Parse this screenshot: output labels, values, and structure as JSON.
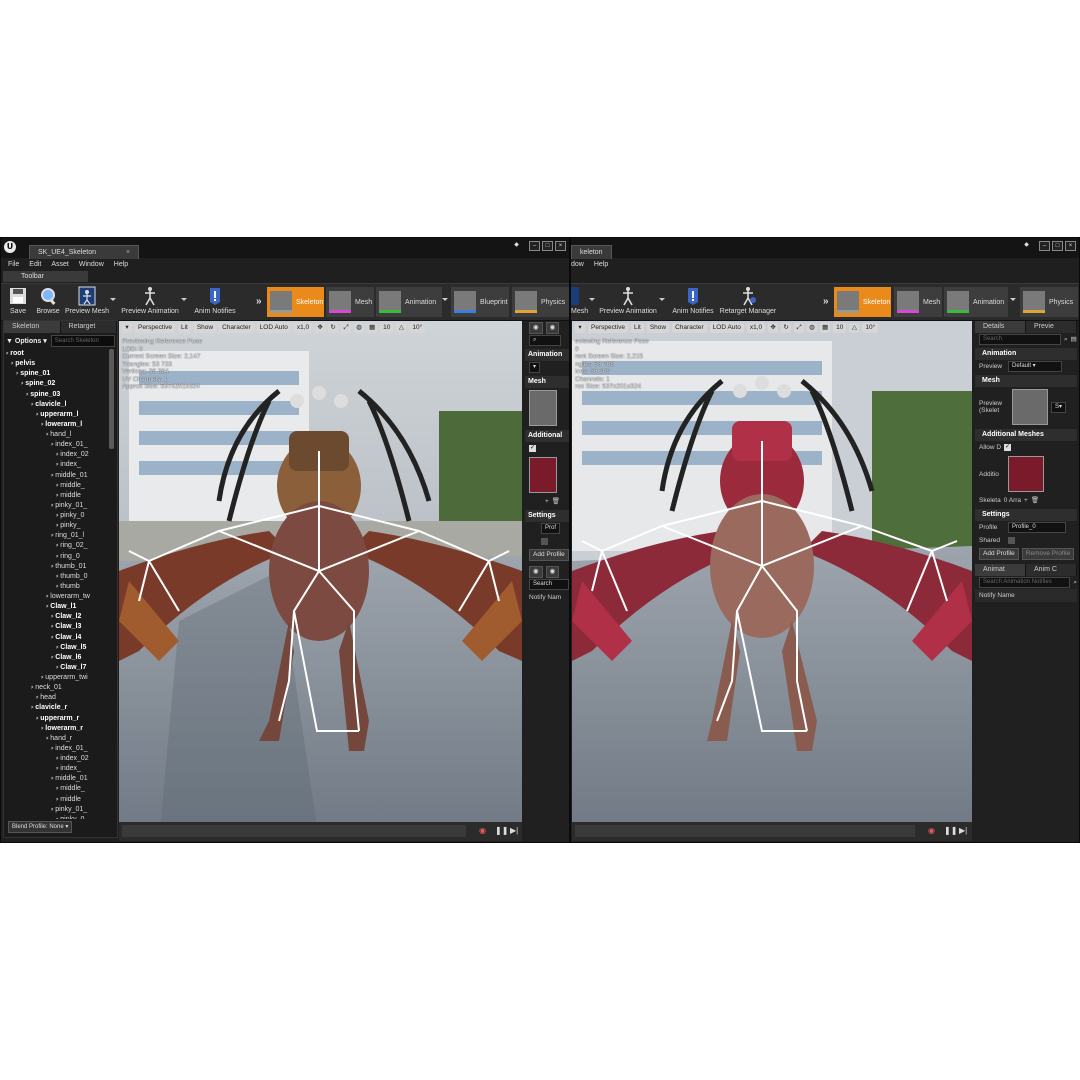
{
  "left_window": {
    "tab_title": "SK_UE4_Skeleton",
    "menu": [
      "File",
      "Edit",
      "Asset",
      "Window",
      "Help"
    ],
    "toolbar_tab": "Toolbar",
    "toolbar": {
      "save": "Save",
      "browse": "Browse",
      "preview_mesh": "Preview Mesh",
      "preview_animation": "Preview Animation",
      "anim_notifies": "Anim Notifies"
    },
    "modes": [
      "Skeleton",
      "Mesh",
      "Animation",
      "Blueprint",
      "Physics"
    ],
    "panel_tabs": [
      "Skeleton",
      "Retarget"
    ],
    "options_label": "Options",
    "search_placeholder": "Search Skeleton",
    "tree": [
      "root",
      "pelvis",
      "spine_01",
      "spine_02",
      "spine_03",
      "clavicle_l",
      "upperarm_l",
      "lowerarm_l",
      "hand_l",
      "index_01_",
      "index_02",
      "index_",
      "middle_01",
      "middle_",
      "middle",
      "pinky_01_",
      "pinky_0",
      "pinky_",
      "ring_01_l",
      "ring_02_",
      "ring_0",
      "thumb_01",
      "thumb_0",
      "thumb",
      "lowerarm_tw",
      "Claw_l1",
      "Claw_l2",
      "Claw_l3",
      "Claw_l4",
      "Claw_l5",
      "Claw_l6",
      "Claw_l7",
      "upperarm_twi",
      "neck_01",
      "head",
      "clavicle_r",
      "upperarm_r",
      "lowerarm_r",
      "hand_r",
      "index_01_",
      "index_02",
      "index_",
      "middle_01",
      "middle_",
      "middle",
      "pinky_01_",
      "pinky_0"
    ],
    "blend_profile": "Blend Profile: None",
    "viewport": {
      "perspective": "Perspective",
      "lit": "Lit",
      "show": "Show",
      "character": "Character",
      "lod": "LOD Auto",
      "speed": "x1,0",
      "grid": "10",
      "angle": "10°",
      "info": [
        "Previewing Reference Pose",
        "LOD: 0",
        "Current Screen Size: 2,147",
        "Triangles: 53 733",
        "Vertices: 36 364",
        "UV Channels: 1",
        "Approx Size: 537x201x324"
      ]
    },
    "side": {
      "animation_hdr": "Animation",
      "mesh_hdr": "Mesh",
      "additional_hdr": "Additional",
      "settings_hdr": "Settings",
      "profile_btn": "Prof",
      "add_profile": "Add Profile",
      "search": "Search",
      "notify_name": "Notify Nam"
    }
  },
  "right_window": {
    "tab_title": "keleton",
    "menu": [
      "dow",
      "Help"
    ],
    "toolbar": {
      "mesh_partial": "Mesh",
      "preview_animation": "Preview Animation",
      "anim_notifies": "Anim Notifies",
      "retarget_manager": "Retarget Manager"
    },
    "modes": [
      "Skeleton",
      "Mesh",
      "Animation",
      "Physics"
    ],
    "viewport": {
      "perspective": "Perspective",
      "lit": "Lit",
      "show": "Show",
      "character": "Character",
      "lod": "LOD Auto",
      "speed": "x1,0",
      "grid": "10",
      "angle": "10°",
      "info": [
        "eviewing Reference Pose",
        "0",
        "rent Screen Size: 2,215",
        "ngles: 53 708",
        "ices: 36 309",
        "Channels: 1",
        "rox Size: 537x201x324"
      ]
    },
    "details": {
      "tabs": [
        "Details",
        "Previe"
      ],
      "search": "Search",
      "animation_hdr": "Animation",
      "preview_label": "Preview",
      "preview_value": "Default",
      "mesh_hdr": "Mesh",
      "preview_skel_label": "Preview (Skelet",
      "additional_hdr": "Additional Meshes",
      "allow_label": "Allow D",
      "addition_label": "Additio",
      "skeleton_label": "Skeleta",
      "array_label": "0 Arra",
      "settings_hdr": "Settings",
      "profile_label": "Profile",
      "profile_value": "Profile_0",
      "shared_label": "Shared",
      "add_profile": "Add Profile",
      "remove_profile": "Remove Profile",
      "anim_tabs": [
        "Animat",
        "Anim C"
      ],
      "notify_search": "Search Animation Notifies",
      "notify_name": "Notify Name"
    }
  }
}
